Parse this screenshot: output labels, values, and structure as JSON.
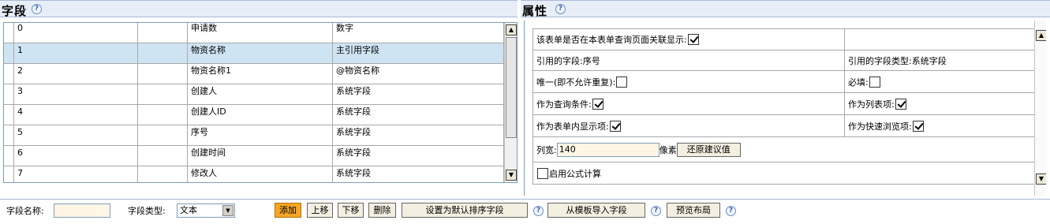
{
  "left": {
    "title": "字段",
    "rows": [
      {
        "index": "0",
        "name": "申请数",
        "type": "数字"
      },
      {
        "index": "1",
        "name": "物资名称",
        "type": "主引用字段",
        "selected": true
      },
      {
        "index": "2",
        "name": "物资名称1",
        "type": "@物资名称"
      },
      {
        "index": "3",
        "name": "创建人",
        "type": "系统字段"
      },
      {
        "index": "4",
        "name": "创建人ID",
        "type": "系统字段"
      },
      {
        "index": "5",
        "name": "序号",
        "type": "系统字段"
      },
      {
        "index": "6",
        "name": "创建时间",
        "type": "系统字段"
      },
      {
        "index": "7",
        "name": "修改人",
        "type": "系统字段"
      }
    ]
  },
  "right": {
    "title": "属性",
    "show_linked_label": "该表单是否在本表单查询页面关联显示:",
    "ref_field_label": "引用的字段:序号",
    "ref_type_label": "引用的字段类型:系统字段",
    "unique_label": "唯一(即不允许重复):",
    "required_label": "必填:",
    "query_cond_label": "作为查询条件:",
    "list_item_label": "作为列表项:",
    "form_display_label": "作为表单内显示项:",
    "quick_browse_label": "作为快速浏览项:",
    "col_width_label": "列宽:",
    "col_width_value": "140",
    "px_unit": "像素",
    "restore_button": "还原建议值",
    "formula_label": "启用公式计算"
  },
  "toolbar": {
    "field_name_label": "字段名称:",
    "field_name_value": "",
    "field_type_label": "字段类型:",
    "field_type_value": "文本",
    "add_label": "添加",
    "up_label": "上移",
    "down_label": "下移",
    "delete_label": "删除",
    "default_sort_label": "设置为默认排序字段",
    "import_template_label": "从模板导入字段",
    "preview_label": "预览布局"
  },
  "help_glyph": "?"
}
